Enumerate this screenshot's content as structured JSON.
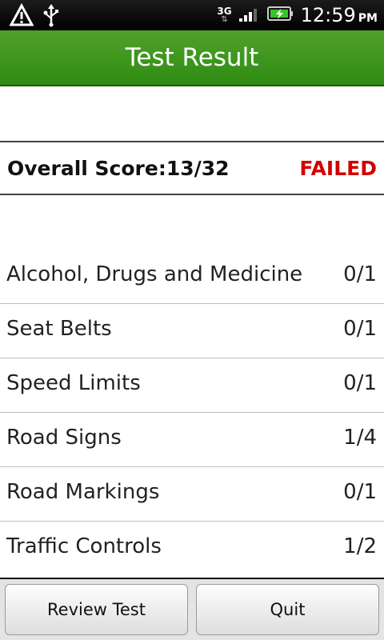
{
  "status_bar": {
    "icons_left": [
      "alert-icon",
      "usb-icon"
    ],
    "network_label": "3G",
    "time": "12:59",
    "ampm": "PM"
  },
  "header": {
    "title": "Test Result"
  },
  "score": {
    "label": "Overall Score:13/32",
    "status": "FAILED",
    "status_color": "#d00000"
  },
  "categories": [
    {
      "name": "Alcohol, Drugs and Medicine",
      "score": "0/1"
    },
    {
      "name": "Seat Belts",
      "score": "0/1"
    },
    {
      "name": "Speed Limits",
      "score": "0/1"
    },
    {
      "name": "Road Signs",
      "score": "1/4"
    },
    {
      "name": "Road Markings",
      "score": "0/1"
    },
    {
      "name": "Traffic Controls",
      "score": "1/2"
    }
  ],
  "buttons": {
    "review_label": "Review Test",
    "quit_label": "Quit"
  },
  "colors": {
    "accent": "#3a9a1c",
    "failed": "#d00000"
  }
}
